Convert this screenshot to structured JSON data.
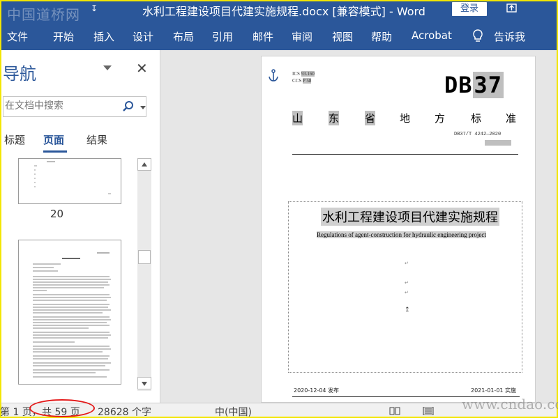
{
  "titlebar": {
    "watermark_left": "中国道桥网",
    "window_title": "水利工程建设项目代建实施规程.docx [兼容模式]  -  Word",
    "login_label": "登录",
    "qa_icon": "quick-access-icon",
    "restore_icon": "restore-icon"
  },
  "ribbon": {
    "tabs": [
      "文件",
      "开始",
      "插入",
      "设计",
      "布局",
      "引用",
      "邮件",
      "审阅",
      "视图",
      "帮助",
      "Acrobat",
      "告诉我"
    ],
    "tell_icon": "lightbulb-icon"
  },
  "nav": {
    "title": "导航",
    "search_placeholder": "在文档中搜索",
    "tabs": [
      "标题",
      "页面",
      "结果"
    ],
    "active_tab": "页面",
    "thumb_page_label": "20"
  },
  "document": {
    "ics_line": "ICS",
    "ics_value": "93.160",
    "ccs_line": "CCS",
    "ccs_value": "P 58",
    "db_code": "DB",
    "db_number": "37",
    "province_chars": [
      "山",
      "东",
      "省",
      "地",
      "方",
      "标",
      "准"
    ],
    "std_number": "DB37/T 4242—2020",
    "title": "水利工程建设项目代建实施规程",
    "subtitle": "Regulations of agent-construction for hydraulic engineering project",
    "publish_date": "2020-12-04 发布",
    "effective_date": "2021-01-01 实施"
  },
  "status": {
    "page_info": "第 1 页，",
    "total_pages": "共 59 页",
    "word_count": "28628 个字",
    "language": "中(中国)",
    "watermark_right": "www.cndao.com"
  },
  "colors": {
    "ribbon_blue": "#2b579a",
    "highlight_gray": "#bfbfbf",
    "annotation_red": "#e41b1b",
    "frame_yellow": "#f3e600"
  }
}
